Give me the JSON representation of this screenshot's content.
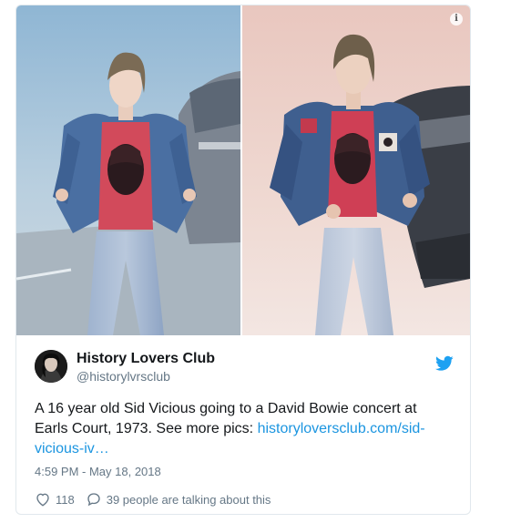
{
  "tweet": {
    "author_name": "History Lovers Club",
    "author_handle": "@historylvrsclub",
    "text_before_link": "A 16 year old Sid Vicious going to a David Bowie concert at Earls Court, 1973. See more pics: ",
    "link_text": "historyloversclub.com/sid-vicious-iv…",
    "timestamp": "4:59 PM - May 18, 2018",
    "like_count": "118",
    "reply_text": "39 people are talking about this"
  },
  "icons": {
    "info": "info-icon",
    "bird": "twitter-bird-icon",
    "like": "heart-icon",
    "reply": "speech-bubble-icon"
  },
  "colors": {
    "link": "#1b95e0",
    "twitter_blue": "#1da1f2",
    "secondary_text": "#657786",
    "border": "#e1e8ed"
  }
}
